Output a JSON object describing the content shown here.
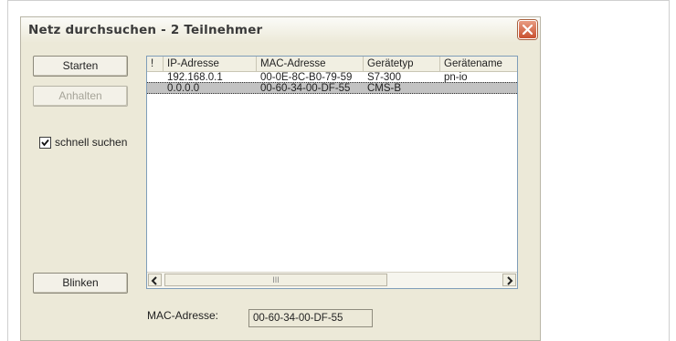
{
  "window": {
    "title": "Netz durchsuchen - 2 Teilnehmer"
  },
  "buttons": {
    "start_label": "Starten",
    "hold_label": "Anhalten",
    "blink_label": "Blinken"
  },
  "options": {
    "fast_search_label": "schnell suchen",
    "fast_search_checked": true
  },
  "table": {
    "columns": [
      "!",
      "IP-Adresse",
      "MAC-Adresse",
      "Gerätetyp",
      "Gerätename"
    ],
    "rows": [
      {
        "flag": "",
        "ip": "192.168.0.1",
        "mac": "00-0E-8C-B0-79-59",
        "type": "S7-300",
        "name": "pn-io",
        "selected": false
      },
      {
        "flag": "",
        "ip": "0.0.0.0",
        "mac": "00-60-34-00-DF-55",
        "type": "CMS-B",
        "name": "",
        "selected": true
      }
    ]
  },
  "scrollbar": {
    "thumb_grip": "III"
  },
  "details": {
    "mac_label": "MAC-Adresse:",
    "mac_value": "00-60-34-00-DF-55"
  },
  "colors": {
    "window_bg": "#ece9d8",
    "close_button": "#c9502f",
    "selection": "#c2c2c2",
    "list_border": "#7f9db9"
  },
  "icons": {
    "close": "close-icon",
    "check": "checkmark-icon",
    "scroll_left": "arrow-left-icon",
    "scroll_right": "arrow-right-icon"
  }
}
